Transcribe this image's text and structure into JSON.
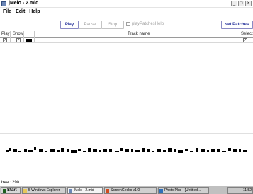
{
  "window": {
    "title": "jMelo - 2.mid",
    "controls": [
      "_",
      "□",
      "×"
    ]
  },
  "menubar": {
    "items": [
      "File",
      "Edit",
      "Help"
    ]
  },
  "toolbar": {
    "play_label": "Play",
    "pause_label": "Pause",
    "stop_label": "Stop",
    "play_patches_label": "playPatchesHelp",
    "set_patches_label": "set Patches"
  },
  "table": {
    "headers": {
      "play": "Play",
      "show": "Show",
      "track": "Track name",
      "select": "Select"
    },
    "rows": [
      {
        "play": "✓",
        "show": "✓",
        "track": "",
        "select": "✓"
      }
    ]
  },
  "status": {
    "beat": "beat: 290"
  },
  "taskbar": {
    "start_label": "Start",
    "tasks": [
      "5 Windows Explorer",
      "jMelo - 2.mid",
      "ScreenGecko v1.0",
      "Photo Plus - [Untitled..."
    ],
    "clock": "11:52"
  },
  "colors": {
    "accent": "#24309a",
    "taskbar": "#c0c0c0"
  }
}
